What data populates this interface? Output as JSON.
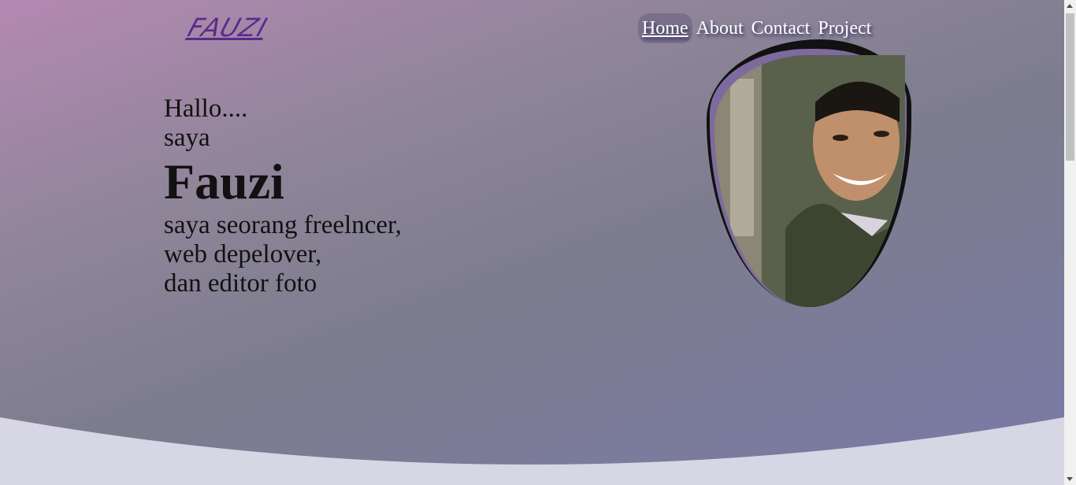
{
  "logo": {
    "text": "FAUZI"
  },
  "nav": {
    "items": [
      {
        "label": "Home",
        "active": true
      },
      {
        "label": "About"
      },
      {
        "label": "Contact"
      },
      {
        "label": "Project"
      }
    ]
  },
  "intro": {
    "greeting": "Hallo....",
    "pre_name": "saya",
    "name": "Fauzi",
    "desc_1": "saya seorang freelncer,",
    "desc_2": "web depelover,",
    "desc_3": "dan editor foto"
  },
  "profile_photo": {
    "icon": "profile-photo"
  },
  "colors": {
    "accent": "#5a2a8a",
    "nav_active_bg": "#7a6f8a",
    "wave_fill": "#d6d6e4"
  }
}
